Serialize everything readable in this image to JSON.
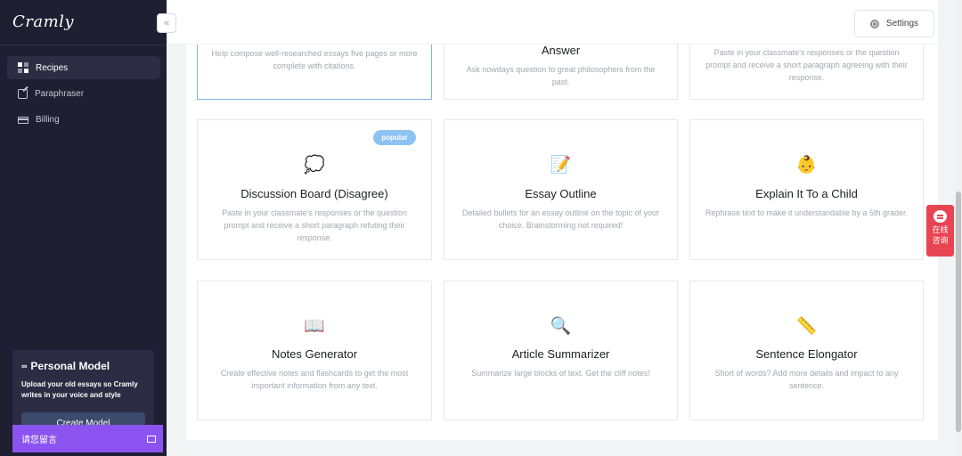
{
  "app": {
    "logo_text": "Cramly"
  },
  "sidebar": {
    "collapse_label": "«",
    "items": [
      {
        "label": "Recipes",
        "icon": "grid-icon",
        "active": true
      },
      {
        "label": "Paraphraser",
        "icon": "edit-icon",
        "active": false
      },
      {
        "label": "Billing",
        "icon": "card-icon",
        "active": false
      }
    ],
    "personal_model": {
      "icon": "glasses-icon",
      "title": "Personal Model",
      "description": "Upload your old essays so Cramly writes in your voice and style",
      "button_label": "Create Model"
    },
    "chat_bar_label": "请您留言"
  },
  "header": {
    "settings_label": "Settings"
  },
  "cards": [
    {
      "title": "",
      "icon": "",
      "description": "Help compose well-researched essays five pages or more complete with citations.",
      "selected": true
    },
    {
      "title": "Answer",
      "icon": "",
      "description": "Ask nowdays question to great philosophers from the past.",
      "selected": false
    },
    {
      "title": "",
      "icon": "",
      "description": "Paste in your classmate's responses or the question prompt and receive a short paragraph agreeing with their response.",
      "selected": false
    },
    {
      "title": "Discussion Board (Disagree)",
      "icon": "💭",
      "badge": "popular",
      "description": "Paste in your classmate's responses or the question prompt and receive a short paragraph refuting their response.",
      "selected": false
    },
    {
      "title": "Essay Outline",
      "icon": "📝",
      "description": "Detailed bullets for an essay outline on the topic of your choice. Brainstorming not required!",
      "selected": false
    },
    {
      "title": "Explain It To a Child",
      "icon": "👶",
      "description": "Rephrase text to make it understandable by a 5th grader.",
      "selected": false
    },
    {
      "title": "Notes Generator",
      "icon": "📖",
      "description": "Create effective notes and flashcards to get the most important information from any text.",
      "selected": false
    },
    {
      "title": "Article Summarizer",
      "icon": "🔍",
      "description": "Summarize large blocks of text. Get the cliff notes!",
      "selected": false
    },
    {
      "title": "Sentence Elongator",
      "icon": "📏",
      "description": "Short of words? Add more details and impact to any sentence.",
      "selected": false
    }
  ],
  "float_chat": {
    "line1": "在线",
    "line2": "咨询"
  }
}
